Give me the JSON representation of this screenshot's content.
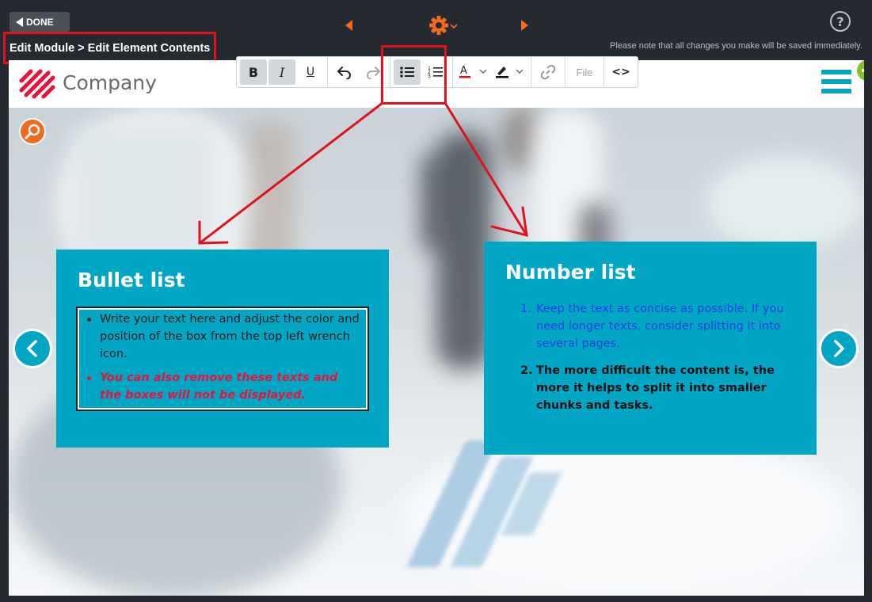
{
  "topbar": {
    "done_label": "DONE",
    "breadcrumb": "Edit Module > Edit Element Contents",
    "help_label": "?",
    "save_note": "Please note that all changes you make will be saved immediately."
  },
  "toolbar": {
    "bold": "B",
    "italic": "I",
    "underline": "U",
    "file_label": "File",
    "code_label": "<>",
    "active_tool": "bullet-list"
  },
  "header": {
    "logo_text": "Company"
  },
  "cards": {
    "bullet": {
      "title": "Bullet list",
      "items": [
        "Write your text here and adjust the color and position of the box from the top left wrench icon.",
        "You can also remove these texts and the boxes will not be displayed."
      ]
    },
    "number": {
      "title": "Number list",
      "items": [
        {
          "num": "1.",
          "text": "Keep the text as concise as possible. If you need longer texts, consider splitting it into several pages."
        },
        {
          "num": "2.",
          "text": "The more difficult the content is, the more it helps to split it into smaller chunks and tasks."
        }
      ]
    }
  },
  "colors": {
    "accent": "#00a6c4",
    "orange": "#f26a1b",
    "annotation_red": "#e0121d",
    "green_badge": "#83c326"
  }
}
